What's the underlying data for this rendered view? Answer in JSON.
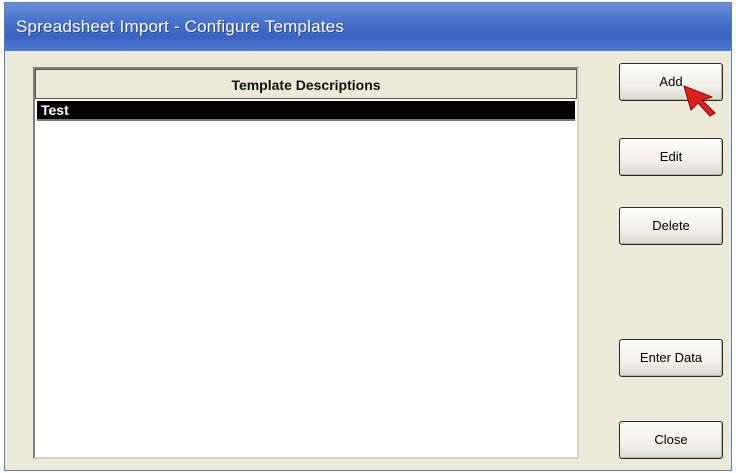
{
  "window": {
    "title": "Spreadsheet Import - Configure Templates"
  },
  "list": {
    "header": "Template Descriptions",
    "rows": [
      {
        "label": "Test",
        "selected": true
      }
    ]
  },
  "buttons": {
    "add": "Add",
    "edit": "Edit",
    "delete": "Delete",
    "enter_data": "Enter Data",
    "close": "Close"
  },
  "cursor": {
    "icon": "pointer-arrow-icon",
    "color": "#e02020"
  },
  "colors": {
    "titlebar": "#3b63c2",
    "dialog_background": "#ece9d8",
    "selection": "#000000"
  }
}
